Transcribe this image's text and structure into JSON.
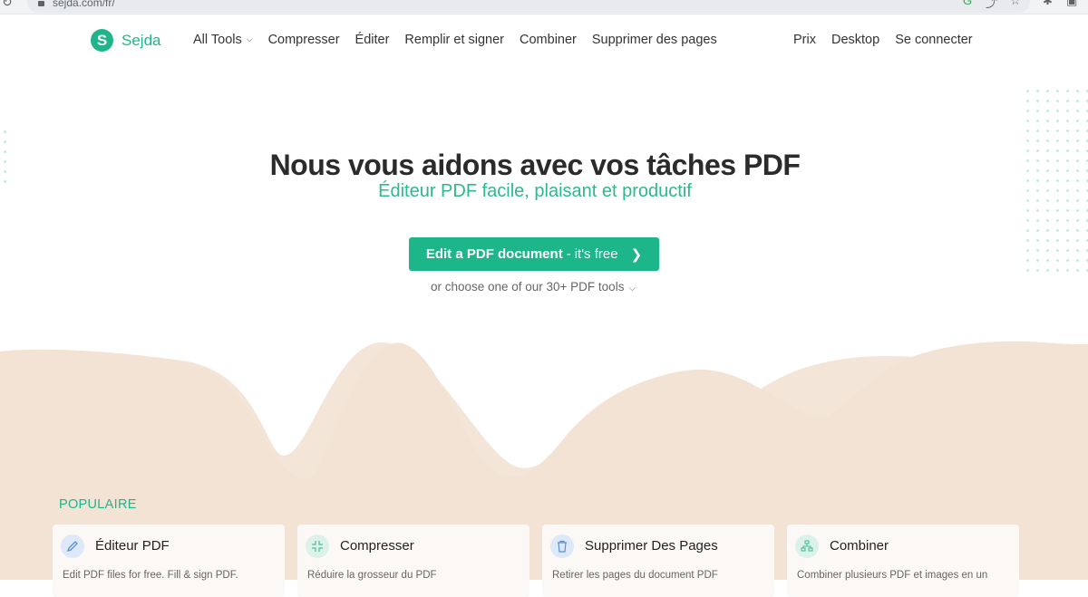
{
  "browser": {
    "url": "sejda.com/fr/"
  },
  "brand": {
    "name": "Sejda",
    "logo_letter": "S",
    "color": "#1fb58b"
  },
  "nav_left": [
    {
      "label": "All Tools",
      "has_dropdown": true
    },
    {
      "label": "Compresser"
    },
    {
      "label": "Éditer"
    },
    {
      "label": "Remplir et signer"
    },
    {
      "label": "Combiner"
    },
    {
      "label": "Supprimer des pages"
    }
  ],
  "nav_right": [
    {
      "label": "Prix"
    },
    {
      "label": "Desktop"
    },
    {
      "label": "Se connecter"
    }
  ],
  "hero": {
    "title": "Nous vous aidons avec vos tâches PDF",
    "subtitle": "Éditeur PDF facile, plaisant et productif",
    "cta_main": "Edit a PDF document",
    "cta_separator": "-",
    "cta_free": "it's free",
    "tools_hint": "or choose one of our 30+ PDF tools"
  },
  "popular": {
    "label": "POPULAIRE",
    "cards": [
      {
        "title": "Éditeur PDF",
        "icon": "pencil-icon",
        "icon_bg": "#dde9f8",
        "icon_color": "#5b8fd6",
        "desc": "Edit PDF files for free. Fill & sign PDF."
      },
      {
        "title": "Compresser",
        "icon": "compress-icon",
        "icon_bg": "#dcf1e9",
        "icon_color": "#4bbf97",
        "desc": "Réduire la grosseur du PDF"
      },
      {
        "title": "Supprimer Des Pages",
        "icon": "trash-icon",
        "icon_bg": "#dde9f8",
        "icon_color": "#5b8fd6",
        "desc": "Retirer les pages du document PDF"
      },
      {
        "title": "Combiner",
        "icon": "merge-icon",
        "icon_bg": "#dcf1e9",
        "icon_color": "#4bbf97",
        "desc": "Combiner plusieurs PDF et images en un"
      }
    ]
  },
  "colors": {
    "accent": "#1fb58b",
    "wave": "#f3e5d8",
    "card_bg": "#fbf8f5"
  }
}
